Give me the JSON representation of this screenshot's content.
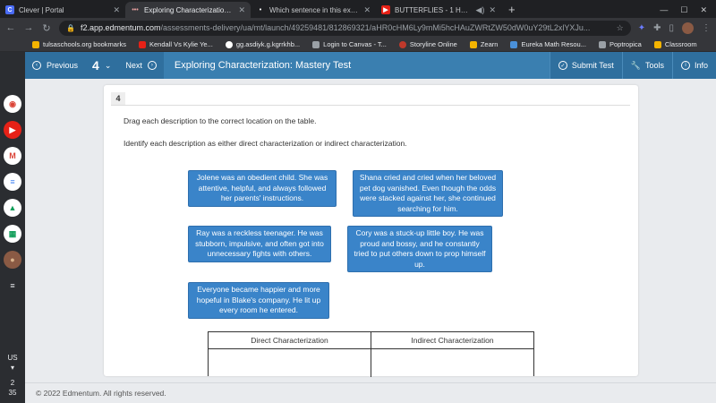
{
  "browser": {
    "tabs": [
      {
        "title": "Clever | Portal",
        "color": "#4a6cf7",
        "glyph": "C"
      },
      {
        "title": "Exploring Characterization: Mas",
        "color": "#c0392b",
        "glyph": "•••"
      },
      {
        "title": "Which sentence in this excerpt fr",
        "color": "#202124",
        "glyph": "•"
      },
      {
        "title": "BUTTERFLIES - 1 HOUR - Yo",
        "color": "#e62117",
        "glyph": "▶"
      }
    ],
    "new_tab": "+",
    "url_host": "f2.app.edmentum.com",
    "url_path": "/assessments-delivery/ua/mt/launch/49259481/812869321/aHR0cHM6Ly9mMi5hcHAuZWRtZW50dW0uY29tL2xlYXJu...",
    "bookmarks": [
      {
        "label": "tulsaschools.org bookmarks",
        "color": "#f4b400"
      },
      {
        "label": "Kendall Vs Kylie Ye...",
        "color": "#e62117"
      },
      {
        "label": "gg.asdiyk.g.kgrrkhb...",
        "color": "#ffffff"
      },
      {
        "label": "Login to Canvas - T...",
        "color": "#9aa0a6"
      },
      {
        "label": "Storyline Online",
        "color": "#c0392b"
      },
      {
        "label": "Zearn",
        "color": "#f4b400"
      },
      {
        "label": "Eureka Math Resou...",
        "color": "#4a90d9"
      },
      {
        "label": "Poptropica",
        "color": "#9aa0a6"
      },
      {
        "label": "Classroom",
        "color": "#f4b400"
      }
    ]
  },
  "shelf": {
    "apps": [
      {
        "name": "chrome-app-icon",
        "color": "#db4437",
        "glyph": "◉"
      },
      {
        "name": "youtube-app-icon",
        "color": "#e62117",
        "glyph": "▶"
      },
      {
        "name": "gmail-app-icon",
        "color": "#db4437",
        "glyph": "M"
      },
      {
        "name": "docs-app-icon",
        "color": "#4285f4",
        "glyph": "≡"
      },
      {
        "name": "drive-app-icon",
        "color": "#0f9d58",
        "glyph": "▲"
      },
      {
        "name": "sheets-app-icon",
        "color": "#0f9d58",
        "glyph": "▦"
      },
      {
        "name": "user-avatar-icon",
        "color": "#8a5a44",
        "glyph": "●"
      },
      {
        "name": "notes-app-icon",
        "color": "#5f6368",
        "glyph": "≡"
      }
    ],
    "locale": "US",
    "time_hour": "2",
    "time_min": "35"
  },
  "header": {
    "previous": "Previous",
    "question_number": "4",
    "next": "Next",
    "title": "Exploring Characterization: Mastery Test",
    "submit": "Submit Test",
    "tools": "Tools",
    "info": "Info"
  },
  "question": {
    "number": "4",
    "instruction1": "Drag each description to the correct location on the table.",
    "instruction2": "Identify each description as either direct characterization or indirect characterization.",
    "tiles": [
      "Jolene was an obedient child. She was attentive, helpful, and always followed her parents' instructions.",
      "Shana cried and cried when her beloved pet dog vanished. Even though the odds were stacked against her, she continued searching for him.",
      "Ray was a reckless teenager. He was stubborn, impulsive, and often got into unnecessary fights with others.",
      "Cory was a stuck-up little boy. He was proud and bossy, and he constantly tried to put others down to prop himself up.",
      "Everyone became happier and more hopeful in Blake's company. He lit up every room he entered."
    ],
    "table_headers": [
      "Direct Characterization",
      "Indirect Characterization"
    ]
  },
  "footer": {
    "copyright": "© 2022 Edmentum. All rights reserved."
  }
}
